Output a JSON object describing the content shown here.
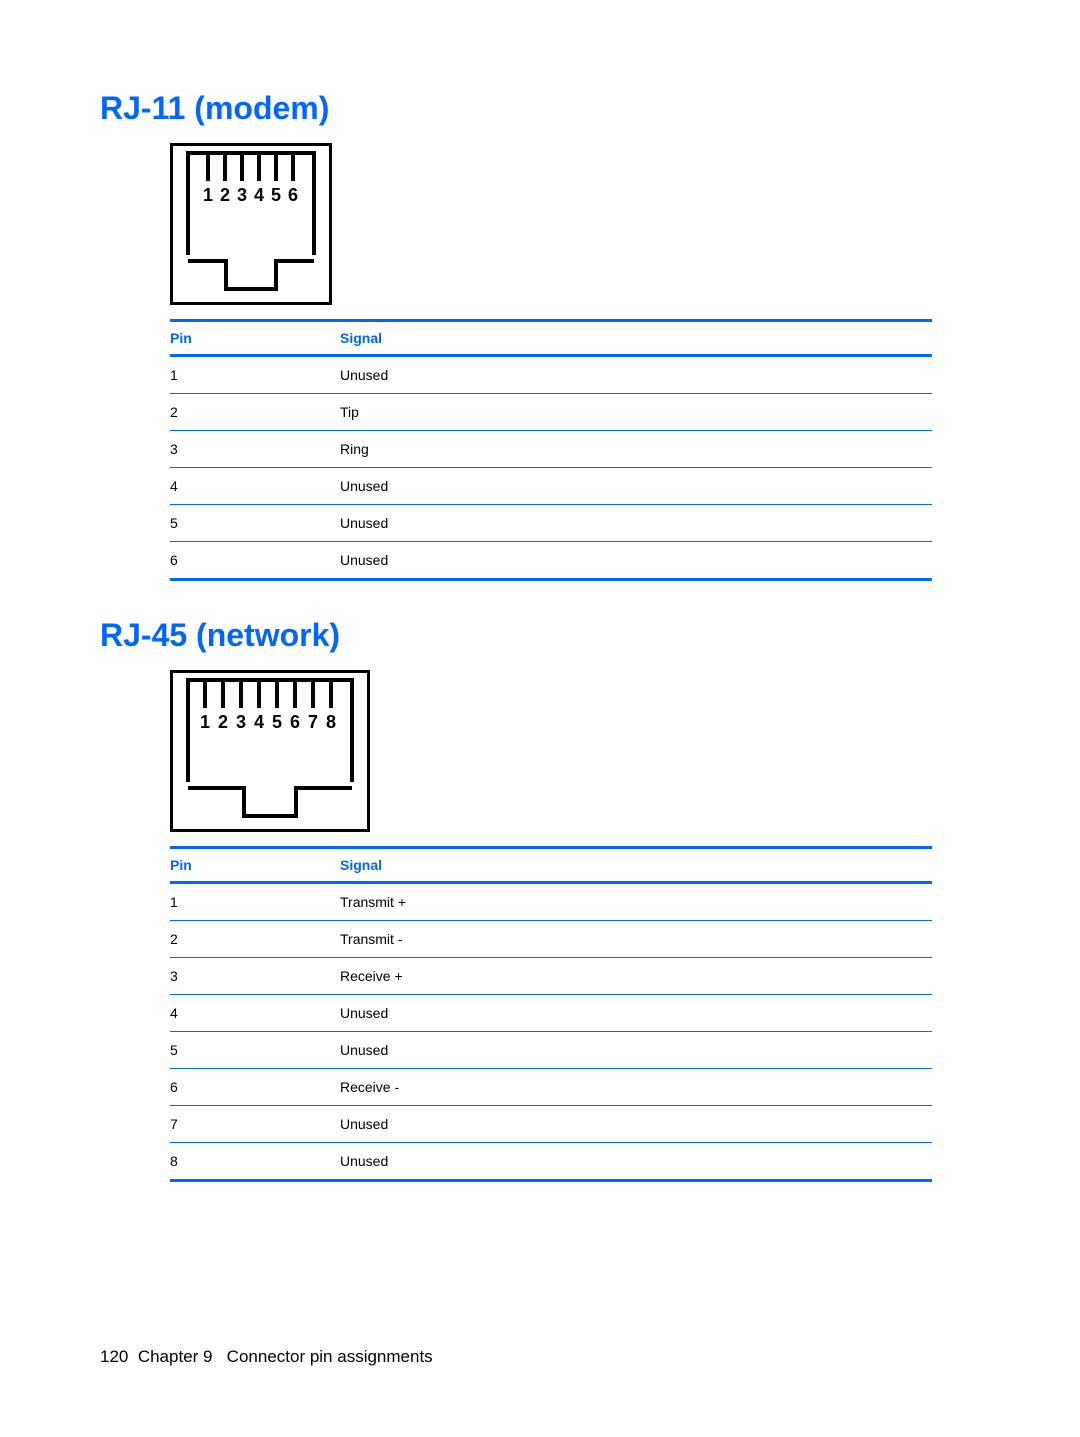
{
  "section1": {
    "heading": "RJ-11 (modem)",
    "connector": {
      "pins": 6,
      "labels": [
        "1",
        "2",
        "3",
        "4",
        "5",
        "6"
      ]
    },
    "table": {
      "headers": {
        "pin": "Pin",
        "signal": "Signal"
      },
      "rows": [
        {
          "pin": "1",
          "signal": "Unused"
        },
        {
          "pin": "2",
          "signal": "Tip"
        },
        {
          "pin": "3",
          "signal": "Ring"
        },
        {
          "pin": "4",
          "signal": "Unused"
        },
        {
          "pin": "5",
          "signal": "Unused"
        },
        {
          "pin": "6",
          "signal": "Unused"
        }
      ]
    }
  },
  "section2": {
    "heading": "RJ-45 (network)",
    "connector": {
      "pins": 8,
      "labels": [
        "1",
        "2",
        "3",
        "4",
        "5",
        "6",
        "7",
        "8"
      ]
    },
    "table": {
      "headers": {
        "pin": "Pin",
        "signal": "Signal"
      },
      "rows": [
        {
          "pin": "1",
          "signal": "Transmit +"
        },
        {
          "pin": "2",
          "signal": "Transmit -"
        },
        {
          "pin": "3",
          "signal": "Receive +"
        },
        {
          "pin": "4",
          "signal": "Unused"
        },
        {
          "pin": "5",
          "signal": "Unused"
        },
        {
          "pin": "6",
          "signal": "Receive -"
        },
        {
          "pin": "7",
          "signal": "Unused"
        },
        {
          "pin": "8",
          "signal": "Unused"
        }
      ]
    }
  },
  "footer": {
    "page_number": "120",
    "chapter_label": "Chapter 9",
    "chapter_title": "Connector pin assignments"
  }
}
